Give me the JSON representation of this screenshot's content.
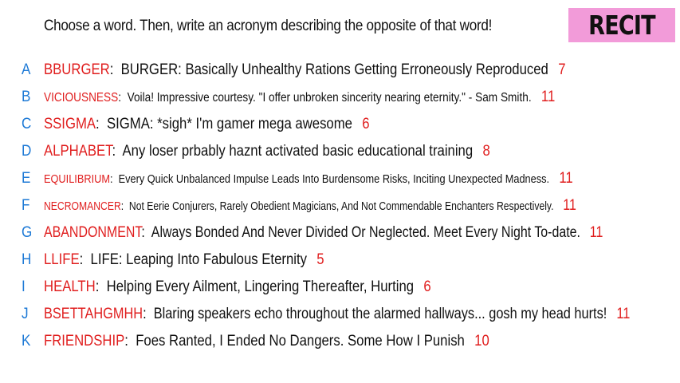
{
  "prompt": "Choose a word. Then, write an acronym describing the opposite of that word!",
  "badge": "RECIT",
  "colors": {
    "letter": "#1e7ad6",
    "word": "#e01e1e",
    "count": "#e01e1e",
    "badge_bg": "#f29bd9"
  },
  "items": [
    {
      "letter": "A",
      "word": "BBURGER",
      "desc": "BURGER: Basically Unhealthy Rations Getting Erroneously Reproduced",
      "count": "7"
    },
    {
      "letter": "B",
      "word": "VICIOUSNESS",
      "desc": "Voila! Impressive courtesy. \"I offer unbroken sincerity nearing eternity.\" - Sam Smith.",
      "count": "11"
    },
    {
      "letter": "C",
      "word": "SSIGMA",
      "desc": "SIGMA: *sigh* I'm gamer mega awesome",
      "count": "6"
    },
    {
      "letter": "D",
      "word": "ALPHABET",
      "desc": "Any loser prbably haznt activated basic educational training",
      "count": "8"
    },
    {
      "letter": "E",
      "word": "EQUILIBRIUM",
      "desc": "Every Quick Unbalanced Impulse Leads Into Burdensome Risks, Inciting Unexpected Madness.",
      "count": "11"
    },
    {
      "letter": "F",
      "word": "NECROMANCER",
      "desc": "Not Eerie Conjurers, Rarely Obedient Magicians, And Not Commendable Enchanters Respectively.",
      "count": "11"
    },
    {
      "letter": "G",
      "word": "ABANDONMENT",
      "desc": "Always Bonded And Never Divided Or Neglected. Meet Every Night To-date.",
      "count": "11"
    },
    {
      "letter": "H",
      "word": "LLIFE",
      "desc": "LIFE: Leaping Into Fabulous Eternity",
      "count": "5"
    },
    {
      "letter": "I",
      "word": "HEALTH",
      "desc": "Helping Every Ailment, Lingering Thereafter, Hurting",
      "count": "6"
    },
    {
      "letter": "J",
      "word": "BSETTAHGMHH",
      "desc": "Blaring speakers echo throughout the alarmed hallways... gosh my head hurts!",
      "count": "11"
    },
    {
      "letter": "K",
      "word": "FRIENDSHIP",
      "desc": "Foes Ranted, I Ended No Dangers. Some How I Punish",
      "count": "10"
    }
  ]
}
